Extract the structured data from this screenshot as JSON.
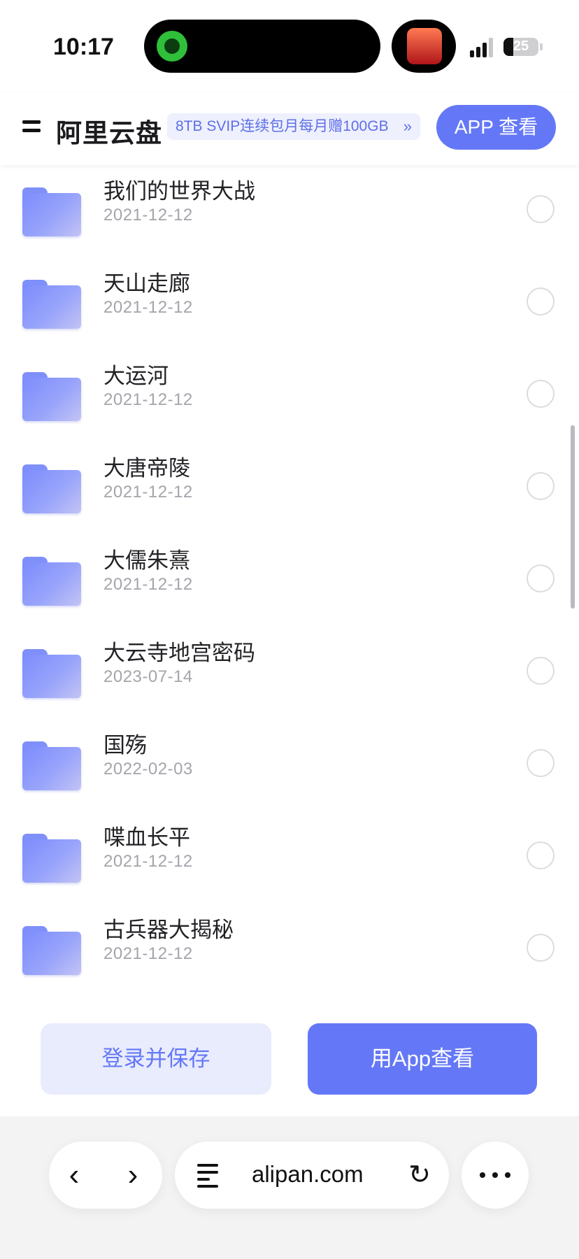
{
  "status_bar": {
    "time": "10:17",
    "battery": "25"
  },
  "header": {
    "brand": "阿里云盘",
    "promo": "8TB SVIP连续包月每月赠100GB",
    "promo_chevron": "»",
    "app_button": "APP 查看"
  },
  "files": [
    {
      "name": "我们的世界大战",
      "date": "2021-12-12"
    },
    {
      "name": "天山走廊",
      "date": "2021-12-12"
    },
    {
      "name": "大运河",
      "date": "2021-12-12"
    },
    {
      "name": "大唐帝陵",
      "date": "2021-12-12"
    },
    {
      "name": "大儒朱熹",
      "date": "2021-12-12"
    },
    {
      "name": "大云寺地宫密码",
      "date": "2023-07-14"
    },
    {
      "name": "国殇",
      "date": "2022-02-03"
    },
    {
      "name": "喋血长平",
      "date": "2021-12-12"
    },
    {
      "name": "古兵器大揭秘",
      "date": "2021-12-12"
    }
  ],
  "actions": {
    "login_save": "登录并保存",
    "view_in_app": "用App查看"
  },
  "browser": {
    "url": "alipan.com",
    "back_glyph": "‹",
    "forward_glyph": "›",
    "reload_glyph": "↻"
  },
  "colors": {
    "accent": "#6478f7",
    "accent_light": "#e9ecfd",
    "folder": "#7c8cfc"
  }
}
